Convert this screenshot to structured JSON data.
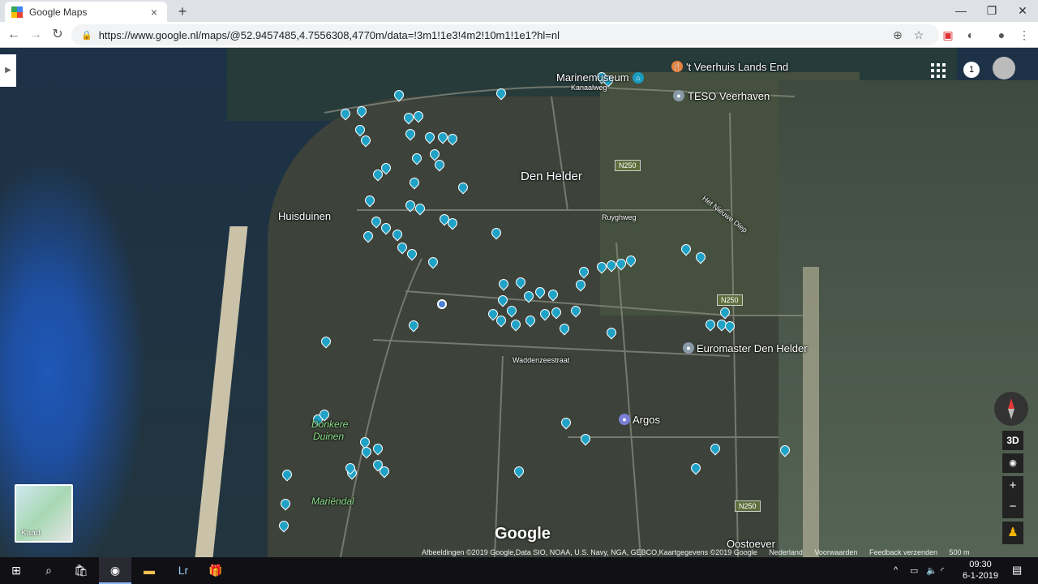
{
  "browser": {
    "tab_title": "Google Maps",
    "url": "https://www.google.nl/maps/@52.9457485,4.7556308,4770m/data=!3m1!1e3!4m2!10m1!1e1?hl=nl",
    "new_tab": "+",
    "close_tab": "×"
  },
  "map": {
    "labels": {
      "den_helder": "Den Helder",
      "huisduinen": "Huisduinen",
      "marinemuseum": "Marinemuseum",
      "veerhuis": "'t Veerhuis Lands End",
      "teso": "TESO Veerhaven",
      "euromaster": "Euromaster Den Helder",
      "argos": "Argos",
      "donkere_duinen": "Donkere Duinen",
      "mariendal": "Mariëndal",
      "oostoever": "Oostoever"
    },
    "roads": {
      "n250a": "N250",
      "n250b": "N250",
      "n250c": "N250",
      "ruyghweg": "Ruyghweg",
      "waddenzeestraat": "Waddenzeestraat",
      "kanaalweg": "Kanaalweg",
      "nieuwe_diep": "Het Nieuwe Diep"
    },
    "controls": {
      "view3d": "3D",
      "zoom_in": "+",
      "zoom_out": "−",
      "kaart": "Kaart",
      "notifications": "1",
      "google_logo": "Google"
    },
    "attribution": {
      "imagery": "Afbeeldingen ©2019 Google,Data SIO, NOAA, U.S. Navy, NGA, GEBCO,Kaartgegevens ©2019 Google",
      "country": "Nederland",
      "terms": "Voorwaarden",
      "feedback": "Feedback verzenden",
      "scale": "500 m"
    }
  },
  "taskbar": {
    "time": "09:30",
    "date": "6-1-2019"
  },
  "colors": {
    "pin": "#1fa2c6",
    "location_dot": "#4c7fd6"
  }
}
